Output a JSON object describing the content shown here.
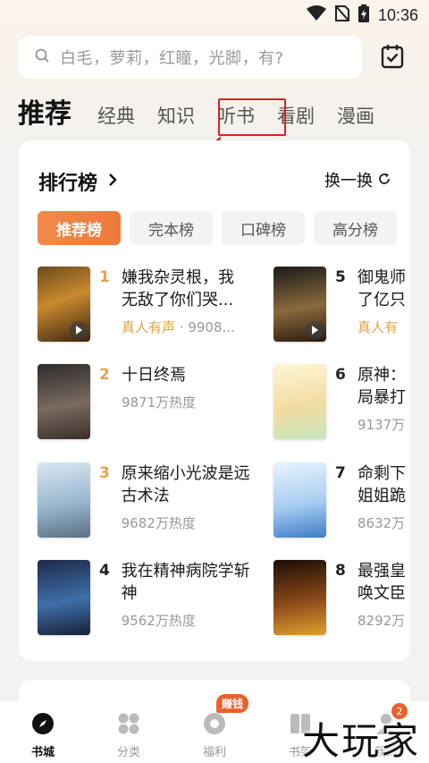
{
  "status_bar": {
    "time": "10:36",
    "icons": [
      "wifi-icon",
      "no-sim-icon",
      "battery-charging-icon"
    ]
  },
  "search": {
    "placeholder": "白毛，萝莉，红瞳，光脚，有?"
  },
  "tabs": [
    "推荐",
    "经典",
    "知识",
    "听书",
    "看剧",
    "漫画"
  ],
  "ranking": {
    "title": "排行榜",
    "refresh_label": "换一换",
    "chips": [
      "推荐榜",
      "完本榜",
      "口碑榜",
      "高分榜"
    ],
    "books": [
      {
        "rank": "1",
        "title": "嫌我杂灵根，我无敌了你们哭...",
        "meta_voice": "真人有声",
        "meta": " · 9908...",
        "audio": true
      },
      {
        "rank": "2",
        "title": "十日终焉",
        "meta": "9871万热度",
        "audio": false
      },
      {
        "rank": "3",
        "title": "原来缩小光波是远古术法",
        "meta": "9682万热度",
        "audio": false
      },
      {
        "rank": "4",
        "title": "我在精神病院学斩神",
        "meta": "9562万热度",
        "audio": false
      },
      {
        "rank": "5",
        "title": "御鬼师了亿只",
        "meta_voice": "真人有",
        "meta": "",
        "audio": true
      },
      {
        "rank": "6",
        "title": "原神：局暴打",
        "meta": "9137万",
        "audio": false
      },
      {
        "rank": "7",
        "title": "命剩下姐姐跪",
        "meta": "8632万",
        "audio": false
      },
      {
        "rank": "8",
        "title": "最强皇唤文臣",
        "meta": "8292万",
        "audio": false
      }
    ]
  },
  "bottom_nav": [
    {
      "label": "书城",
      "icon": "compass-icon"
    },
    {
      "label": "分类",
      "icon": "grid-icon"
    },
    {
      "label": "福利",
      "icon": "gift-icon",
      "badge": "赚钱"
    },
    {
      "label": "书架",
      "icon": "bookshelf-icon"
    },
    {
      "label": "我的",
      "icon": "user-icon",
      "badge": "2"
    }
  ],
  "watermark": "大玩家",
  "colors": {
    "accent": "#ED7A3B",
    "rank_gold": "#E2A44A",
    "highlight": "#E02020"
  }
}
